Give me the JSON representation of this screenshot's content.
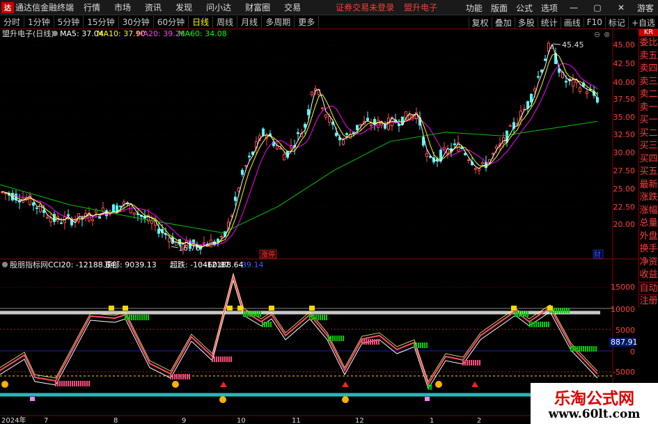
{
  "titlebar": {
    "app_name": "通达信金融终端",
    "menus": [
      "行情",
      "市场",
      "资讯",
      "发现",
      "问小达",
      "财富圈",
      "交易"
    ],
    "notice": "证券交易未登录",
    "stock": "盟升电子",
    "right_items": [
      "功能",
      "版面",
      "公式",
      "选项",
      "游客"
    ]
  },
  "toolbar": {
    "periods": [
      "分时",
      "1分钟",
      "5分钟",
      "15分钟",
      "30分钟",
      "60分钟",
      "日线",
      "周线",
      "月线",
      "多周期",
      "更多"
    ],
    "selected": "日线",
    "right_items": [
      "复权",
      "叠加",
      "多股",
      "统计",
      "画线",
      "F10",
      "标记",
      "+自选"
    ]
  },
  "chart": {
    "title": "盟升电子(日线)",
    "ma5": "MA5: 37.04",
    "ma10": "MA10: 37.90",
    "ma20": "MA20: 39.26",
    "ma60": "MA60: 34.08",
    "high_label": "45.45",
    "low_label": "16.76",
    "price_ticks": [
      "45.00",
      "42.50",
      "40.00",
      "37.50",
      "35.00",
      "32.50",
      "30.00",
      "27.50",
      "25.00",
      "22.50",
      "20.00"
    ],
    "tag_zt": "涨停",
    "tag_cai": "财"
  },
  "indicator": {
    "name": "殷朋指标网",
    "cci": "CCI20: -12188.64",
    "top": "顶部: 9039.13",
    "oversold": "超跌: -10460.87",
    "value": ": -12188.64",
    "extra": "39.14",
    "ticks": [
      "15000",
      "10000",
      "5000",
      "0",
      "-5000"
    ],
    "current": "887.91"
  },
  "xaxis": {
    "labels": [
      "2024年",
      "7",
      "8",
      "9",
      "10",
      "11",
      "12",
      "1",
      "2"
    ]
  },
  "right_panel": {
    "items": [
      "委比",
      "卖五",
      "卖四",
      "卖三",
      "卖二",
      "卖一",
      "买一",
      "买二",
      "买三",
      "买四",
      "买五",
      "最新",
      "涨跌",
      "涨幅",
      "总量",
      "外盘",
      "换手",
      "净资",
      "收益"
    ],
    "tag": "KR",
    "items2": [
      "自动",
      "注册"
    ]
  },
  "watermark": {
    "line1": "乐淘公式网",
    "line2": "www.60lt.com"
  },
  "window": {
    "minimize": "—",
    "maximize": "▢",
    "close": "✕"
  },
  "colors": {
    "up": "#ff4d4d",
    "down": "#54ffff",
    "ma5": "#ffffff",
    "ma10": "#ffff00",
    "ma20": "#ff00ff",
    "ma60": "#00c800"
  }
}
